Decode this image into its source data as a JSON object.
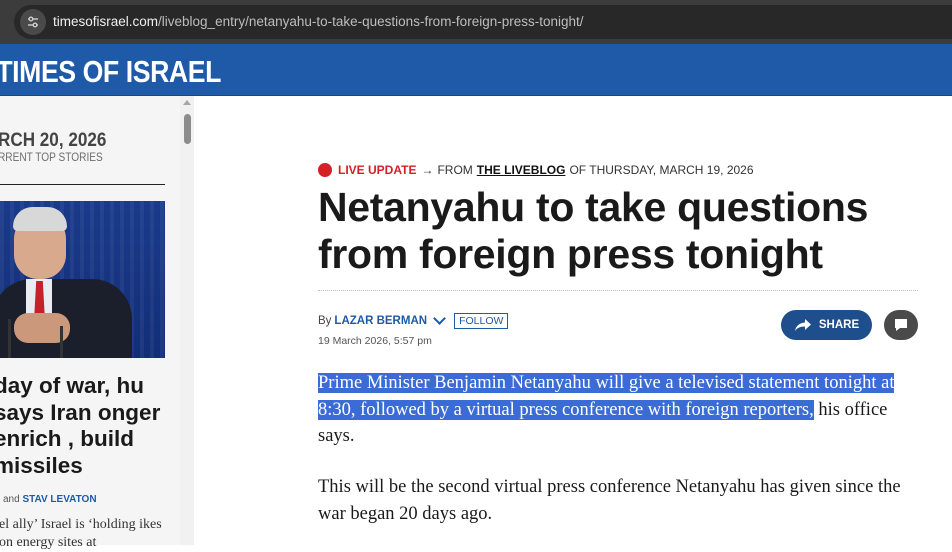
{
  "browser": {
    "url_host": "timesofisrael.com",
    "url_path": "/liveblog_entry/netanyahu-to-take-questions-from-foreign-press-tonight/"
  },
  "masthead": {
    "logo_text": "E TIMES OF ISRAEL",
    "brand_color": "#1e5aa8"
  },
  "sidebar": {
    "date": "RCH 20, 2026",
    "subtitle": "RRENT TOP STORIES",
    "lead_story": {
      "headline": "day of war, hu says Iran onger enrich , build missiles",
      "byline_and": "and",
      "byline_author": "STAV LEVATON",
      "dek": "el ally’ Israel is ‘holding ikes on energy sites at"
    }
  },
  "article": {
    "live_label": "LIVE UPDATE",
    "arrow": "→",
    "from_label": "FROM",
    "liveblog_link": "THE LIVEBLOG",
    "liveblog_date": "OF THURSDAY, MARCH 19, 2026",
    "title": "Netanyahu to take questions from foreign press tonight",
    "by": "By",
    "author": "LAZAR BERMAN",
    "follow_label": "FOLLOW",
    "timestamp": "19 March 2026, 5:57 pm",
    "share_label": "SHARE",
    "paragraph1_selected": "Prime Minister Benjamin Netanyahu will give a televised statement tonight at 8:30, followed by a virtual press conference with foreign reporters,",
    "paragraph1_rest": " his office says.",
    "paragraph2": "This will be the second virtual press conference Netanyahu has given since the war began 20 days ago.",
    "live_color": "#d42026",
    "selection_color": "#3b6bd4"
  }
}
